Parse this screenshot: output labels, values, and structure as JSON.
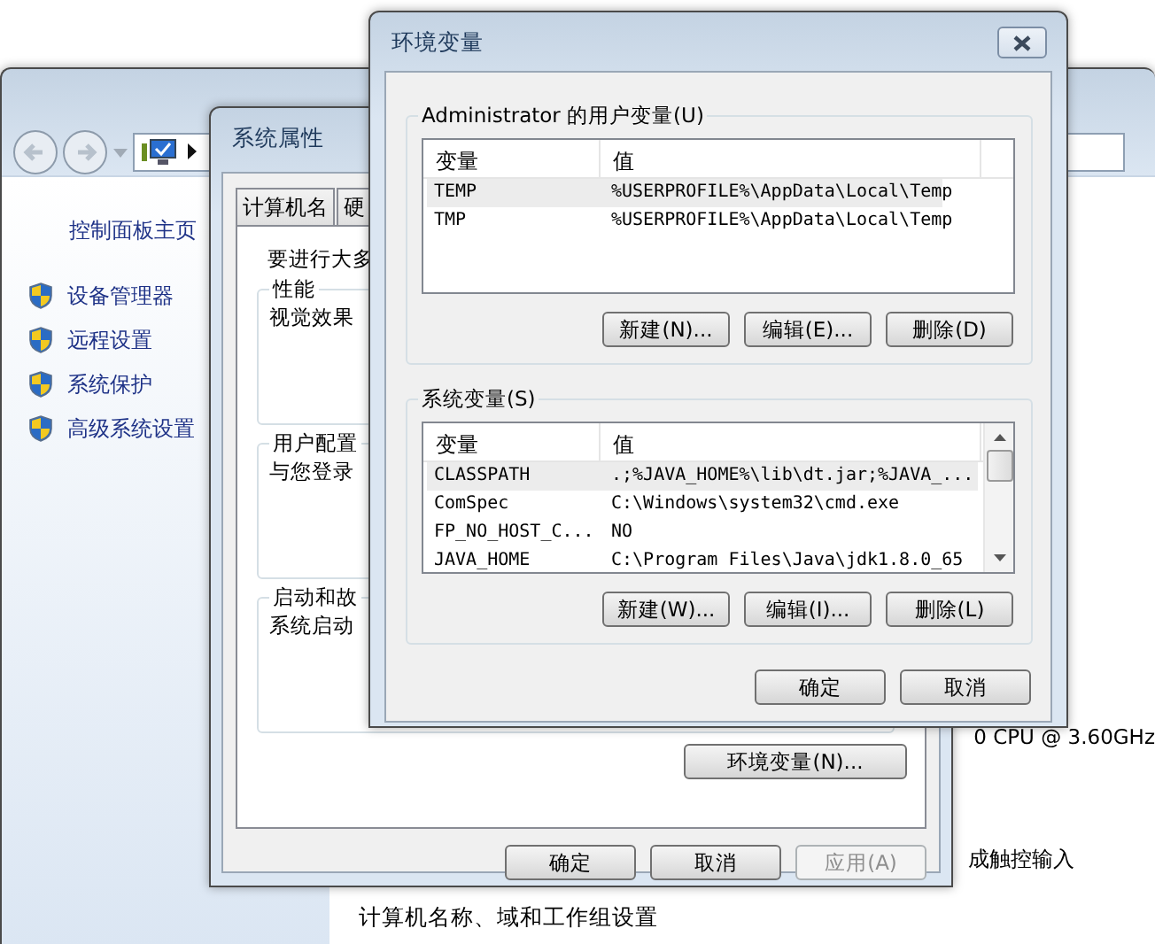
{
  "control_panel": {
    "home_link": "控制面板主页",
    "tasks": [
      {
        "label": "设备管理器"
      },
      {
        "label": "远程设置"
      },
      {
        "label": "系统保护"
      },
      {
        "label": "高级系统设置"
      }
    ],
    "cpu_text": "0 CPU @ 3.60GHz",
    "touch_text": "成触控输入",
    "section_heading": "计算机名称、域和工作组设置"
  },
  "system_properties": {
    "title": "系统属性",
    "tabs": [
      {
        "label": "计算机名",
        "selected": false
      },
      {
        "label": "硬",
        "selected": false
      }
    ],
    "intro": "要进行大多",
    "groups": [
      {
        "legend": "性能",
        "text": "视觉效果"
      },
      {
        "legend": "用户配置",
        "text": "与您登录"
      },
      {
        "legend": "启动和故",
        "text": "系统启动"
      }
    ],
    "env_button": "环境变量(N)...",
    "buttons": [
      {
        "label": "确定",
        "disabled": false
      },
      {
        "label": "取消",
        "disabled": false
      },
      {
        "label": "应用(A)",
        "disabled": true
      }
    ]
  },
  "environment_variables": {
    "title": "环境变量",
    "user_group": {
      "legend": "Administrator 的用户变量(U)",
      "columns": [
        "变量",
        "值"
      ],
      "rows": [
        {
          "name": "TEMP",
          "value": "%USERPROFILE%\\AppData\\Local\\Temp",
          "selected": true
        },
        {
          "name": "TMP",
          "value": "%USERPROFILE%\\AppData\\Local\\Temp",
          "selected": false
        }
      ],
      "buttons": [
        "新建(N)...",
        "编辑(E)...",
        "删除(D)"
      ]
    },
    "system_group": {
      "legend": "系统变量(S)",
      "columns": [
        "变量",
        "值"
      ],
      "rows": [
        {
          "name": "CLASSPATH",
          "value": ".;%JAVA_HOME%\\lib\\dt.jar;%JAVA_...",
          "selected": true
        },
        {
          "name": "ComSpec",
          "value": "C:\\Windows\\system32\\cmd.exe",
          "selected": false
        },
        {
          "name": "FP_NO_HOST_C...",
          "value": "NO",
          "selected": false
        },
        {
          "name": "JAVA_HOME",
          "value": "C:\\Program Files\\Java\\jdk1.8.0_65",
          "selected": false
        }
      ],
      "buttons": [
        "新建(W)...",
        "编辑(I)...",
        "删除(L)"
      ]
    },
    "buttons": [
      "确定",
      "取消"
    ]
  }
}
